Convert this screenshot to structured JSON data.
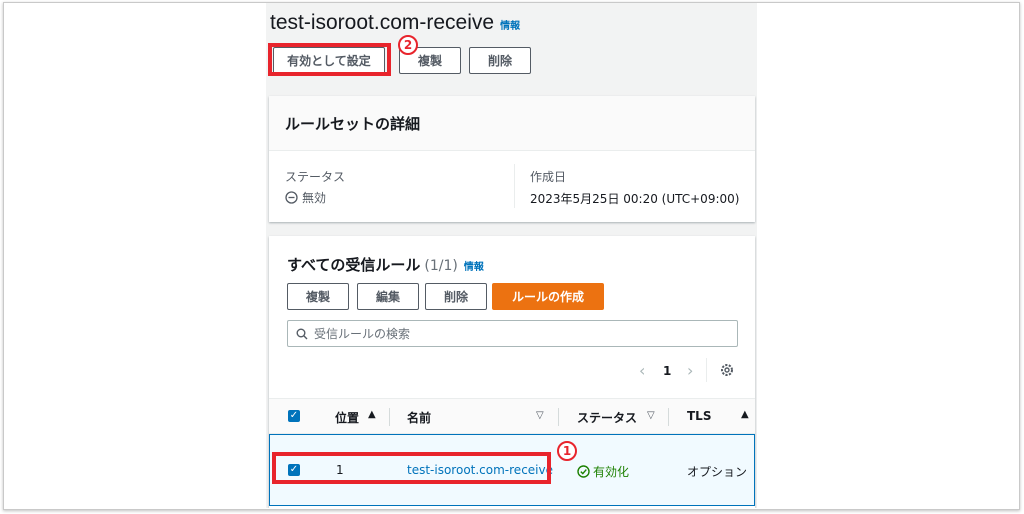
{
  "header": {
    "title": "test-isoroot.com-receive",
    "info_label": "情報"
  },
  "actions": {
    "set_active": "有効として設定",
    "duplicate": "複製",
    "delete": "削除"
  },
  "details": {
    "title": "ルールセットの詳細",
    "status_label": "ステータス",
    "status_value": "無効",
    "created_label": "作成日",
    "created_value": "2023年5月25日 00:20 (UTC+09:00)"
  },
  "rules": {
    "title": "すべての受信ルール",
    "count": "(1/1)",
    "info_label": "情報",
    "duplicate": "複製",
    "edit": "編集",
    "delete": "削除",
    "create": "ルールの作成",
    "search_placeholder": "受信ルールの検索",
    "page": "1",
    "columns": {
      "position": "位置",
      "name": "名前",
      "status": "ステータス",
      "tls": "TLS"
    },
    "rows": [
      {
        "position": "1",
        "name": "test-isoroot.com-receive",
        "status": "有効化",
        "tls": "オプション"
      }
    ]
  },
  "annotations": {
    "badge1": "1",
    "badge2": "2"
  },
  "colors": {
    "link": "#0073bb",
    "primary": "#ec7211",
    "success": "#1d8102",
    "highlight": "#e8242c"
  }
}
